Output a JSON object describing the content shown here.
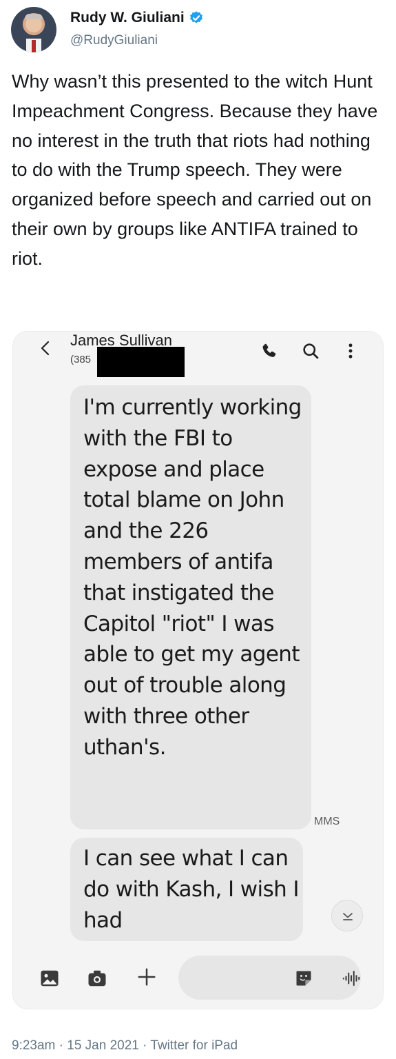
{
  "tweet": {
    "author_name": "Rudy W. Giuliani",
    "handle": "@RudyGiuliani",
    "text": "Why wasn’t this presented to the witch Hunt Impeachment Congress. Because they have no interest in the truth that riots had nothing to do with the Trump speech. They were organized before speech and carried out on their own by groups like ANTIFA trained to riot.",
    "meta": "9:23am · 15 Jan 2021 · Twitter for iPad",
    "verified_color": "#1da1f2"
  },
  "sms": {
    "contact_name": "James Sullivan",
    "contact_number_visible": "(385",
    "message_1": "I'm currently working with the FBI to expose and place total blame on John and the 226 members of antifa that instigated the Capitol \"riot\" I was able to get my agent out of trouble along with three other uthan's.",
    "message_1_tag": "MMS",
    "message_2": "I can see what I can do with Kash, I wish I had"
  },
  "icons": {
    "back": "chevron-left-icon",
    "call": "phone-icon",
    "search": "search-icon",
    "more": "more-vertical-icon",
    "scroll": "chevron-down-icon",
    "gallery": "image-icon",
    "camera": "camera-icon",
    "add": "plus-icon",
    "sticker": "sticker-icon",
    "voice": "voice-wave-icon"
  }
}
